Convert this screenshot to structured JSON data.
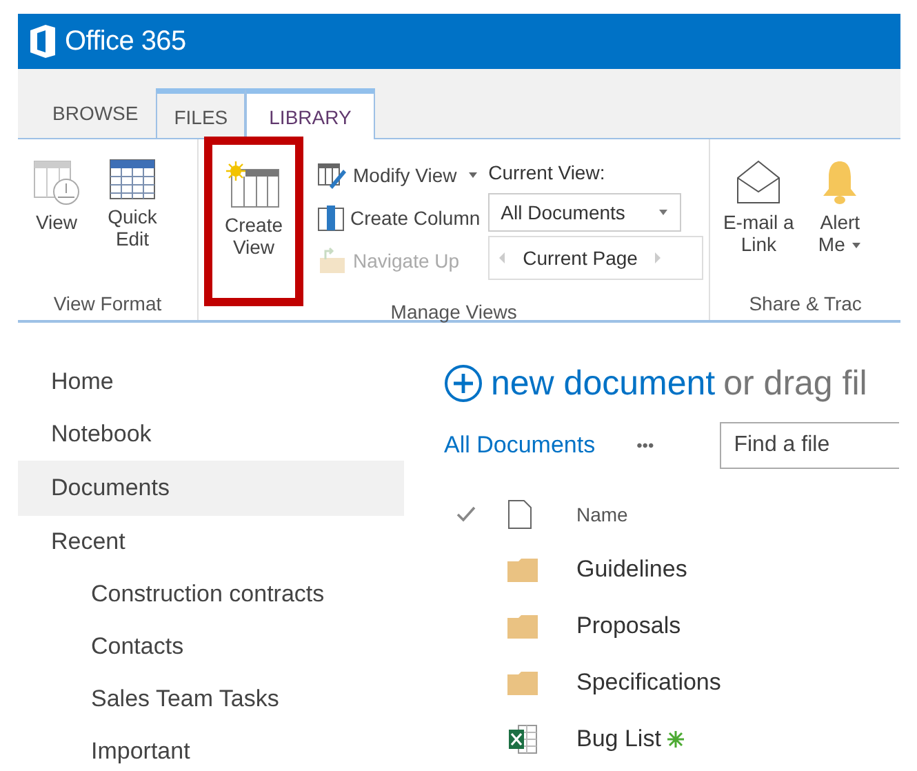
{
  "suite_bar": {
    "title": "Office 365"
  },
  "ribbon": {
    "tabs": [
      {
        "label": "BROWSE",
        "selected": false,
        "contextual": false
      },
      {
        "label": "FILES",
        "selected": false,
        "contextual": true
      },
      {
        "label": "LIBRARY",
        "selected": true,
        "contextual": true
      }
    ],
    "groups": [
      {
        "label": "View Format",
        "columns": [
          [
            {
              "kind": "large",
              "label": "View"
            }
          ],
          [
            {
              "kind": "large",
              "label": "Quick Edit"
            }
          ]
        ]
      },
      {
        "label": "Manage Views",
        "columns": [
          [
            {
              "kind": "large",
              "label": "Create View",
              "highlighted": true
            }
          ],
          [
            {
              "kind": "small",
              "label": "Modify View",
              "dropdown": true,
              "disabled": false
            },
            {
              "kind": "small",
              "label": "Create Column",
              "dropdown": false,
              "disabled": false
            },
            {
              "kind": "small",
              "label": "Navigate Up",
              "dropdown": false,
              "disabled": true
            }
          ],
          [
            {
              "kind": "label",
              "label": "Current View:"
            },
            {
              "kind": "select",
              "value": "All Documents"
            },
            {
              "kind": "pager",
              "label": "Current Page"
            }
          ]
        ]
      },
      {
        "label": "Share & Trac",
        "columns": [
          [
            {
              "kind": "large",
              "label": "E-mail a Link"
            }
          ],
          [
            {
              "kind": "large",
              "label": "Alert Me",
              "dropdown": true
            }
          ]
        ]
      }
    ]
  },
  "nav": {
    "items": [
      {
        "label": "Home",
        "selected": false
      },
      {
        "label": "Notebook",
        "selected": false
      },
      {
        "label": "Documents",
        "selected": true
      },
      {
        "label": "Recent",
        "selected": false,
        "children": [
          {
            "label": "Construction contracts",
            "selected": false
          },
          {
            "label": "Contacts",
            "selected": false
          },
          {
            "label": "Sales Team Tasks",
            "selected": false
          },
          {
            "label": "Important",
            "selected": false
          }
        ]
      }
    ]
  },
  "library": {
    "new_action": "new document",
    "new_hint": "or drag fil",
    "view_link": "All Documents",
    "more": "•••",
    "search": {
      "placeholder": "Find a file"
    },
    "columns": [
      "Name"
    ],
    "rows": [
      {
        "kind": "folder",
        "name": "Guidelines",
        "is_new": false
      },
      {
        "kind": "folder",
        "name": "Proposals",
        "is_new": false
      },
      {
        "kind": "folder",
        "name": "Specifications",
        "is_new": false
      },
      {
        "kind": "excel",
        "name": "Bug List",
        "is_new": true
      }
    ]
  }
}
